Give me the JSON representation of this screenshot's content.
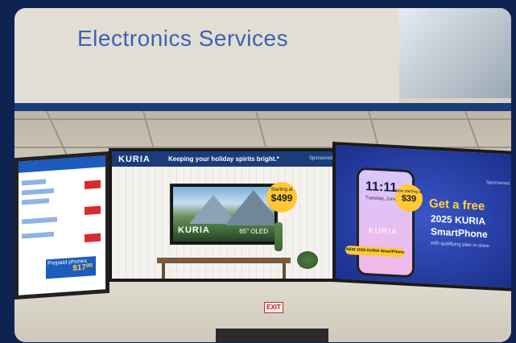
{
  "banner": {
    "title": "Electronics Services"
  },
  "left_screen": {
    "promo_text": "Prepaid phones",
    "promo_price": "$17⁰⁰"
  },
  "center_screen": {
    "logo": "KURIA",
    "tagline": "Keeping your holiday spirits bright.*",
    "sponsored": "Sponsored",
    "tv_logo": "KURIA",
    "tv_size": "65\" OLED",
    "badge_small": "Starting at",
    "badge_price": "$499"
  },
  "right_screen": {
    "sponsored": "Sponsored",
    "phone_time": "11:11",
    "phone_date": "Tuesday, June 4",
    "phone_logo": "KURIA",
    "badge_small": "Now starting at",
    "badge_price": "$39",
    "pill": "NEW 2025 KURIA SmartPhone",
    "offer_line1": "Get a free",
    "offer_line2": "2025 KURIA",
    "offer_line3": "SmartPhone",
    "offer_line4": "with qualifying plan in-store."
  },
  "signage": {
    "exit": "EXIT"
  },
  "colors": {
    "frame": "#0e2350",
    "brand_blue": "#1a3c7a",
    "accent_yellow": "#ffc933"
  }
}
